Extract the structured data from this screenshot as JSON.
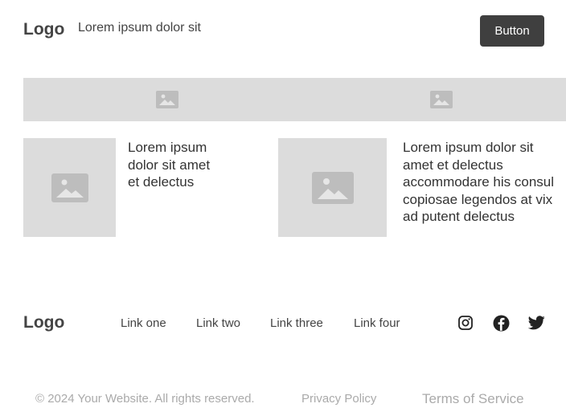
{
  "header": {
    "logo": "Logo",
    "tagline": "Lorem ipsum dolor sit",
    "button_label": "Button"
  },
  "cards": [
    {
      "text": "Lorem ipsum dolor sit amet et delectus"
    },
    {
      "text": "Lorem ipsum dolor sit amet et delectus accommodare his consul copiosae legendos at vix ad putent delectus"
    }
  ],
  "footer": {
    "logo": "Logo",
    "links": [
      "Link one",
      "Link two",
      "Link three",
      "Link four"
    ],
    "social": [
      "instagram-icon",
      "facebook-icon",
      "twitter-icon"
    ],
    "copyright": "© 2024 Your Website. All rights reserved.",
    "privacy": "Privacy Policy",
    "terms": "Terms of Service"
  },
  "colors": {
    "placeholder": "#dcdcdc",
    "placeholder_icon": "#bdbdbd",
    "button_bg": "#3f3f3f",
    "muted_text": "#aaaaaa"
  }
}
